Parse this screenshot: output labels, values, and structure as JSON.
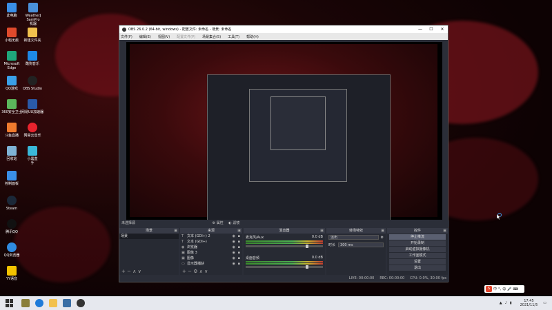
{
  "desktop_icons": [
    {
      "label": "此电脑",
      "color": "#3a8ee6"
    },
    {
      "label": "猎豹看图",
      "color": "#2d9cdb"
    },
    {
      "label": "WeatherJ\nSamPro\n机器",
      "color": "#4a90d9"
    },
    {
      "label": "小稻无痕",
      "color": "#e04a2c"
    },
    {
      "label": "新建文件夹",
      "color": "#f2c14e"
    },
    {
      "label": "Microsoft\nEdge",
      "color": "#1fa67a"
    },
    {
      "label": "酷狗音乐",
      "color": "#1e88e5"
    },
    {
      "label": "QQ游戏",
      "color": "#3aa0e8"
    },
    {
      "label": "OBS Studio",
      "color": "#222"
    },
    {
      "label": "360安全卫士",
      "color": "#5cb85c"
    },
    {
      "label": "网易UU加速器",
      "color": "#2a5aa8"
    },
    {
      "label": "斗鱼直播",
      "color": "#f07b2e"
    },
    {
      "label": "网易云音乐",
      "color": "#e8232d"
    },
    {
      "label": "回收站",
      "color": "#7fb3d5"
    },
    {
      "label": "小黑盒\n手",
      "color": "#3ab8d9"
    },
    {
      "label": "控制面板",
      "color": "#3a8ee6"
    },
    {
      "label": "Steam",
      "color": "#1b2838"
    },
    {
      "label": "腾讯QQ",
      "color": "#111"
    },
    {
      "label": "QQ浏览器",
      "color": "#2f8be0"
    },
    {
      "label": "YY语音",
      "color": "#f3c300"
    }
  ],
  "obs": {
    "title": "OBS 26.0.2 (64-bit, windows) - 配置文件: 未命名 - 场景: 未命名",
    "window_controls": {
      "minimize": "—",
      "maximize": "☐",
      "close": "✕"
    },
    "menu": [
      "文件(F)",
      "编辑(E)",
      "视图(V)",
      "配置文件(P)",
      "场景集合(S)",
      "工具(T)",
      "帮助(H)"
    ],
    "panel_bar": {
      "label": "未选择源",
      "properties": "属性",
      "filters": "滤镜"
    },
    "docks": {
      "scenes": {
        "title": "场景",
        "items": [
          "场景"
        ]
      },
      "sources": {
        "title": "来源",
        "items": [
          {
            "label": "文本 (GDI+) 2",
            "icon": "T"
          },
          {
            "label": "文本 (GDI+)",
            "icon": "T"
          },
          {
            "label": "浏览器",
            "icon": "◉"
          },
          {
            "label": "图像 3",
            "icon": "▣"
          },
          {
            "label": "图像",
            "icon": "▣"
          },
          {
            "label": "显示器捕获",
            "icon": "▭"
          }
        ]
      },
      "mixer": {
        "title": "混音器",
        "channels": [
          {
            "name": "麦克风/Aux",
            "db": "0.0 dB",
            "level": 0.65
          },
          {
            "name": "桌面音频",
            "db": "0.0 dB",
            "level": 0.65
          }
        ]
      },
      "transitions": {
        "title": "转场特效",
        "type": "淡出",
        "duration_label": "时长",
        "duration": "300 ms"
      },
      "controls": {
        "title": "控件",
        "buttons": [
          "停止推流",
          "开始录制",
          "启动虚拟摄像机",
          "工作室模式",
          "设置",
          "退出"
        ]
      }
    },
    "status": {
      "live": "LIVE: 00:00:00",
      "rec": "REC: 00:00:00",
      "cpu": "CPU: 0.0%, 30.00 fps"
    }
  },
  "taskbar": {
    "time": "17:45",
    "date": "2021/11/5",
    "ime_labels": [
      "中",
      "°,",
      "☺",
      "🎤",
      "⌨",
      "👕",
      "⋯"
    ]
  }
}
